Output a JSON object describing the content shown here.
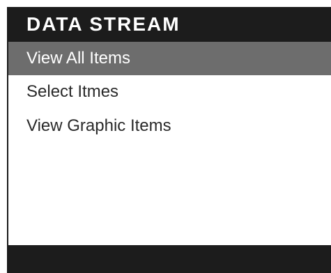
{
  "header": {
    "title": "DATA STREAM"
  },
  "menu": {
    "items": [
      {
        "label": "View All Items",
        "selected": true
      },
      {
        "label": "Select Itmes",
        "selected": false
      },
      {
        "label": "View Graphic Items",
        "selected": false
      }
    ]
  },
  "colors": {
    "title_bar": "#1c1c1c",
    "selected_item": "#6d6d6d",
    "background": "#ffffff"
  }
}
